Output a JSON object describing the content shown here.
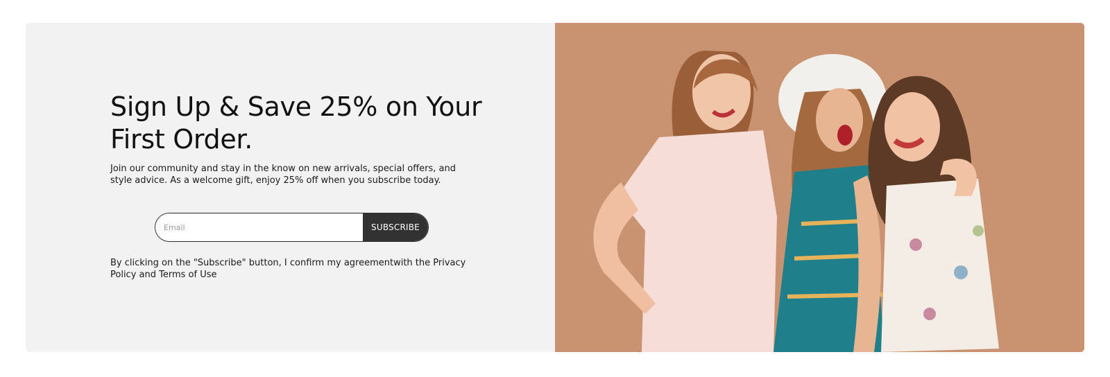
{
  "newsletter": {
    "headline": "Sign Up & Save 25% on Your First Order.",
    "intro": "Join our community and stay in the know on new arrivals, special offers, and style advice. As a welcome gift, enjoy 25% off when you subscribe today.",
    "email_placeholder": "Email",
    "email_value": "",
    "subscribe_label": "SUBSCRIBE",
    "consent": "By clicking on the \"Subscribe\" button, I confirm my agreementwith the Privacy Policy and Terms of Use"
  },
  "hero_image": {
    "subject": "three-smiling-women-photo",
    "background_color": "#c99372"
  },
  "colors": {
    "panel_background": "#f2f2f2",
    "button_background": "#323232",
    "button_text": "#ffffff",
    "text": "#111111"
  }
}
